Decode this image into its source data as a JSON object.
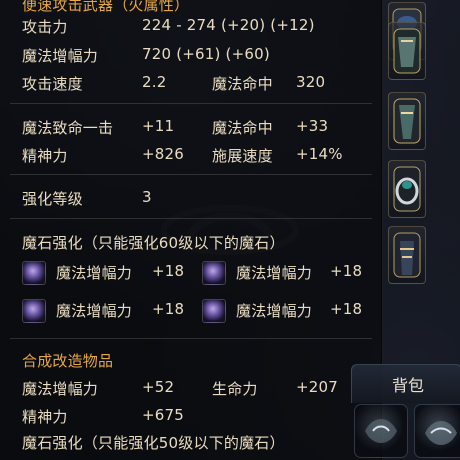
{
  "tooltip": {
    "title_partial": "便速攻击武器（火属性）",
    "rows": {
      "attack": {
        "label": "攻击力",
        "value": "224 - 274 (+20) (+12)"
      },
      "magic_amp": {
        "label": "魔法增幅力",
        "value": "720 (+61) (+60)"
      },
      "attack_speed": {
        "label": "攻击速度",
        "value": "2.2"
      },
      "magic_hit": {
        "label": "魔法命中",
        "value": "320"
      },
      "magic_crit": {
        "label": "魔法致命一击",
        "value": "+11"
      },
      "magic_hit2": {
        "label": "魔法命中",
        "value": "+33"
      },
      "spirit": {
        "label": "精神力",
        "value": "+826"
      },
      "cast_speed": {
        "label": "施展速度",
        "value": "+14%"
      },
      "enchant": {
        "label": "强化等级",
        "value": "3"
      }
    },
    "manastone_section_title": "魔石强化（只能强化60级以下的魔石）",
    "manastones": [
      {
        "label": "魔法增幅力",
        "value": "+18"
      },
      {
        "label": "魔法增幅力",
        "value": "+18"
      },
      {
        "label": "魔法增幅力",
        "value": "+18"
      },
      {
        "label": "魔法增幅力",
        "value": "+18"
      }
    ],
    "fusion_title": "合成改造物品",
    "fusion": {
      "magic_amp": {
        "label": "魔法增幅力",
        "value": "+52"
      },
      "hp": {
        "label": "生命力",
        "value": "+207"
      },
      "spirit": {
        "label": "精神力",
        "value": "+675"
      }
    },
    "fusion_manastone_title": "魔石强化（只能强化50级以下的魔石）"
  },
  "inventory": {
    "bag_tab_label": "背包"
  },
  "colors": {
    "text": "#e9dcc1",
    "gold": "#e4a742"
  },
  "icons": {
    "manastone": "manastone-icon",
    "equipment": "equipment-icon"
  }
}
